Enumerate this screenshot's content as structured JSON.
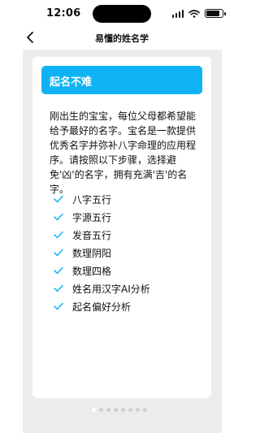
{
  "status_bar": {
    "time": "12:06",
    "battery_level": 0.85
  },
  "nav": {
    "title": "易懂的姓名学",
    "back_icon": "chevron-left-icon"
  },
  "banner": {
    "title": "起名不难",
    "color": "#0fb3f4"
  },
  "intro": {
    "text": "刚出生的宝宝，每位父母都希望能给予最好的名字。宝名是一款提供优秀名字并弥补八字命理的应用程序。请按照以下步骤，选择避免'凶'的名字，拥有充满'吉'的名字。"
  },
  "features": {
    "icon": "checkmark-icon",
    "check_color": "#0fb3f4",
    "items": [
      {
        "label": "八字五行"
      },
      {
        "label": "字源五行"
      },
      {
        "label": "发音五行"
      },
      {
        "label": "数理阴阳"
      },
      {
        "label": "数理四格"
      },
      {
        "label": "姓名用汉字AI分析"
      },
      {
        "label": "起名偏好分析"
      }
    ]
  },
  "pager": {
    "page_count": 8,
    "current_page": 1
  }
}
